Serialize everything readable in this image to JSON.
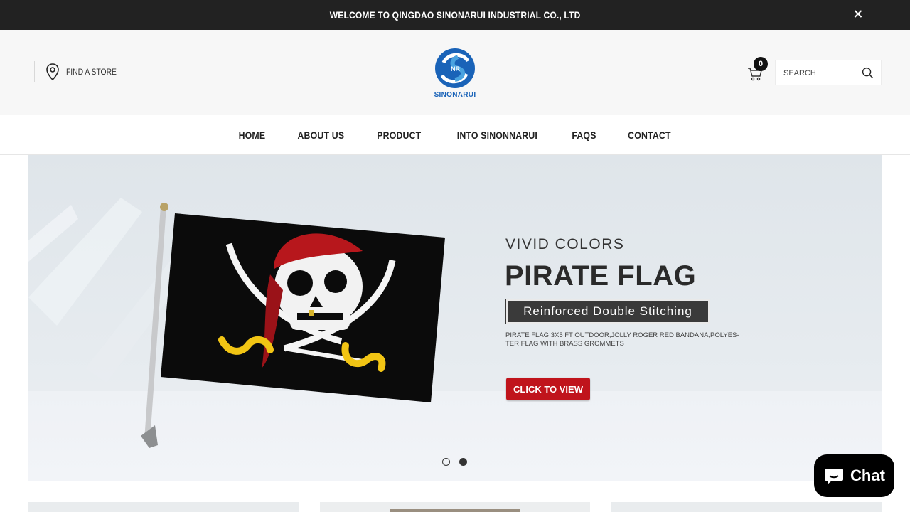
{
  "announcement": {
    "text": "WELCOME TO QINGDAO SINONARUI INDUSTRIAL CO., LTD",
    "close_icon": "close-icon"
  },
  "header": {
    "store_link": {
      "label": "FIND A STORE",
      "icon": "map-pin-icon"
    },
    "logo": {
      "text": "SINONARUI",
      "colors": [
        "#1a63b8",
        "#4aa3e0"
      ]
    },
    "cart": {
      "count": "0",
      "icon": "cart-icon"
    },
    "search": {
      "placeholder": "SEARCH",
      "value": "",
      "icon": "search-icon"
    }
  },
  "nav": {
    "items": [
      {
        "label": "HOME"
      },
      {
        "label": "ABOUT US"
      },
      {
        "label": "PRODUCT"
      },
      {
        "label": "INTO SINONNARUI"
      },
      {
        "label": "FAQS"
      },
      {
        "label": "CONTACT"
      }
    ]
  },
  "hero": {
    "subtitle": "VIVID COLORS",
    "title": "PIRATE FLAG",
    "badge": "Reinforced Double Stitching",
    "description": "PIRATE FLAG 3X5 FT OUTDOOR,JOLLY ROGER RED BANDANA,POLYES-TER FLAG WITH BRASS GROMMETS",
    "cta_label": "CLICK TO VIEW",
    "cta_color": "#c0141c",
    "slides": {
      "count": 2,
      "active": 2
    }
  },
  "chat": {
    "label": "Chat",
    "icon": "chat-bubble-icon",
    "color": "#000000"
  }
}
